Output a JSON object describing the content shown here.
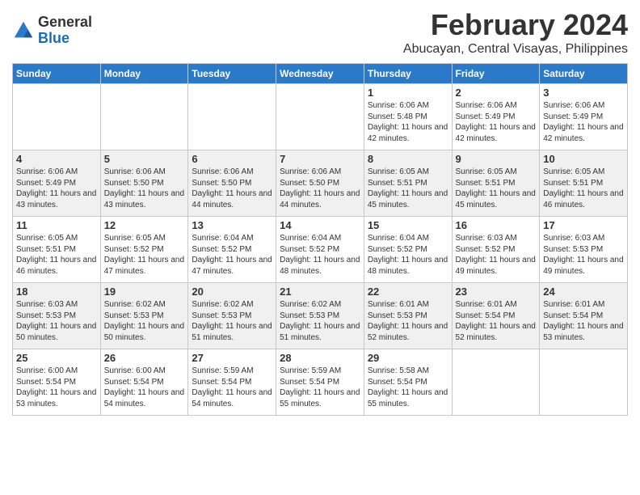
{
  "header": {
    "logo": {
      "general": "General",
      "blue": "Blue"
    },
    "month_year": "February 2024",
    "location": "Abucayan, Central Visayas, Philippines"
  },
  "weekdays": [
    "Sunday",
    "Monday",
    "Tuesday",
    "Wednesday",
    "Thursday",
    "Friday",
    "Saturday"
  ],
  "weeks": [
    [
      {
        "day": "",
        "info": ""
      },
      {
        "day": "",
        "info": ""
      },
      {
        "day": "",
        "info": ""
      },
      {
        "day": "",
        "info": ""
      },
      {
        "day": "1",
        "info": "Sunrise: 6:06 AM\nSunset: 5:48 PM\nDaylight: 11 hours and 42 minutes."
      },
      {
        "day": "2",
        "info": "Sunrise: 6:06 AM\nSunset: 5:49 PM\nDaylight: 11 hours and 42 minutes."
      },
      {
        "day": "3",
        "info": "Sunrise: 6:06 AM\nSunset: 5:49 PM\nDaylight: 11 hours and 42 minutes."
      }
    ],
    [
      {
        "day": "4",
        "info": "Sunrise: 6:06 AM\nSunset: 5:49 PM\nDaylight: 11 hours and 43 minutes."
      },
      {
        "day": "5",
        "info": "Sunrise: 6:06 AM\nSunset: 5:50 PM\nDaylight: 11 hours and 43 minutes."
      },
      {
        "day": "6",
        "info": "Sunrise: 6:06 AM\nSunset: 5:50 PM\nDaylight: 11 hours and 44 minutes."
      },
      {
        "day": "7",
        "info": "Sunrise: 6:06 AM\nSunset: 5:50 PM\nDaylight: 11 hours and 44 minutes."
      },
      {
        "day": "8",
        "info": "Sunrise: 6:05 AM\nSunset: 5:51 PM\nDaylight: 11 hours and 45 minutes."
      },
      {
        "day": "9",
        "info": "Sunrise: 6:05 AM\nSunset: 5:51 PM\nDaylight: 11 hours and 45 minutes."
      },
      {
        "day": "10",
        "info": "Sunrise: 6:05 AM\nSunset: 5:51 PM\nDaylight: 11 hours and 46 minutes."
      }
    ],
    [
      {
        "day": "11",
        "info": "Sunrise: 6:05 AM\nSunset: 5:51 PM\nDaylight: 11 hours and 46 minutes."
      },
      {
        "day": "12",
        "info": "Sunrise: 6:05 AM\nSunset: 5:52 PM\nDaylight: 11 hours and 47 minutes."
      },
      {
        "day": "13",
        "info": "Sunrise: 6:04 AM\nSunset: 5:52 PM\nDaylight: 11 hours and 47 minutes."
      },
      {
        "day": "14",
        "info": "Sunrise: 6:04 AM\nSunset: 5:52 PM\nDaylight: 11 hours and 48 minutes."
      },
      {
        "day": "15",
        "info": "Sunrise: 6:04 AM\nSunset: 5:52 PM\nDaylight: 11 hours and 48 minutes."
      },
      {
        "day": "16",
        "info": "Sunrise: 6:03 AM\nSunset: 5:52 PM\nDaylight: 11 hours and 49 minutes."
      },
      {
        "day": "17",
        "info": "Sunrise: 6:03 AM\nSunset: 5:53 PM\nDaylight: 11 hours and 49 minutes."
      }
    ],
    [
      {
        "day": "18",
        "info": "Sunrise: 6:03 AM\nSunset: 5:53 PM\nDaylight: 11 hours and 50 minutes."
      },
      {
        "day": "19",
        "info": "Sunrise: 6:02 AM\nSunset: 5:53 PM\nDaylight: 11 hours and 50 minutes."
      },
      {
        "day": "20",
        "info": "Sunrise: 6:02 AM\nSunset: 5:53 PM\nDaylight: 11 hours and 51 minutes."
      },
      {
        "day": "21",
        "info": "Sunrise: 6:02 AM\nSunset: 5:53 PM\nDaylight: 11 hours and 51 minutes."
      },
      {
        "day": "22",
        "info": "Sunrise: 6:01 AM\nSunset: 5:53 PM\nDaylight: 11 hours and 52 minutes."
      },
      {
        "day": "23",
        "info": "Sunrise: 6:01 AM\nSunset: 5:54 PM\nDaylight: 11 hours and 52 minutes."
      },
      {
        "day": "24",
        "info": "Sunrise: 6:01 AM\nSunset: 5:54 PM\nDaylight: 11 hours and 53 minutes."
      }
    ],
    [
      {
        "day": "25",
        "info": "Sunrise: 6:00 AM\nSunset: 5:54 PM\nDaylight: 11 hours and 53 minutes."
      },
      {
        "day": "26",
        "info": "Sunrise: 6:00 AM\nSunset: 5:54 PM\nDaylight: 11 hours and 54 minutes."
      },
      {
        "day": "27",
        "info": "Sunrise: 5:59 AM\nSunset: 5:54 PM\nDaylight: 11 hours and 54 minutes."
      },
      {
        "day": "28",
        "info": "Sunrise: 5:59 AM\nSunset: 5:54 PM\nDaylight: 11 hours and 55 minutes."
      },
      {
        "day": "29",
        "info": "Sunrise: 5:58 AM\nSunset: 5:54 PM\nDaylight: 11 hours and 55 minutes."
      },
      {
        "day": "",
        "info": ""
      },
      {
        "day": "",
        "info": ""
      }
    ]
  ]
}
